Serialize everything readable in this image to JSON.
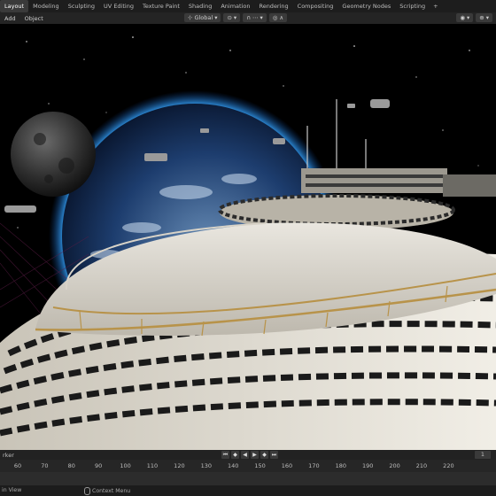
{
  "workspace_tabs": [
    "Layout",
    "Modeling",
    "Sculpting",
    "UV Editing",
    "Texture Paint",
    "Shading",
    "Animation",
    "Rendering",
    "Compositing",
    "Geometry Nodes",
    "Scripting"
  ],
  "active_tab": "Layout",
  "add_workspace": "+",
  "header": {
    "menu_add": "Add",
    "menu_object": "Object",
    "transform_orientation": "Global"
  },
  "timeline": {
    "marker_label": "rker",
    "current_frame": "1",
    "ruler_ticks": [
      "60",
      "70",
      "80",
      "90",
      "100",
      "110",
      "120",
      "130",
      "140",
      "150",
      "160",
      "170",
      "180",
      "190",
      "200",
      "210",
      "220"
    ]
  },
  "status": {
    "left_item": "in View",
    "right_item": "Context Menu"
  },
  "icons": {
    "play": "play-icon",
    "pause": "pause-icon",
    "jump_start": "jump-start-icon",
    "jump_end": "jump-end-icon"
  },
  "colors": {
    "accent": "#3d6fb3",
    "ui_bg": "#1d1d1d"
  }
}
